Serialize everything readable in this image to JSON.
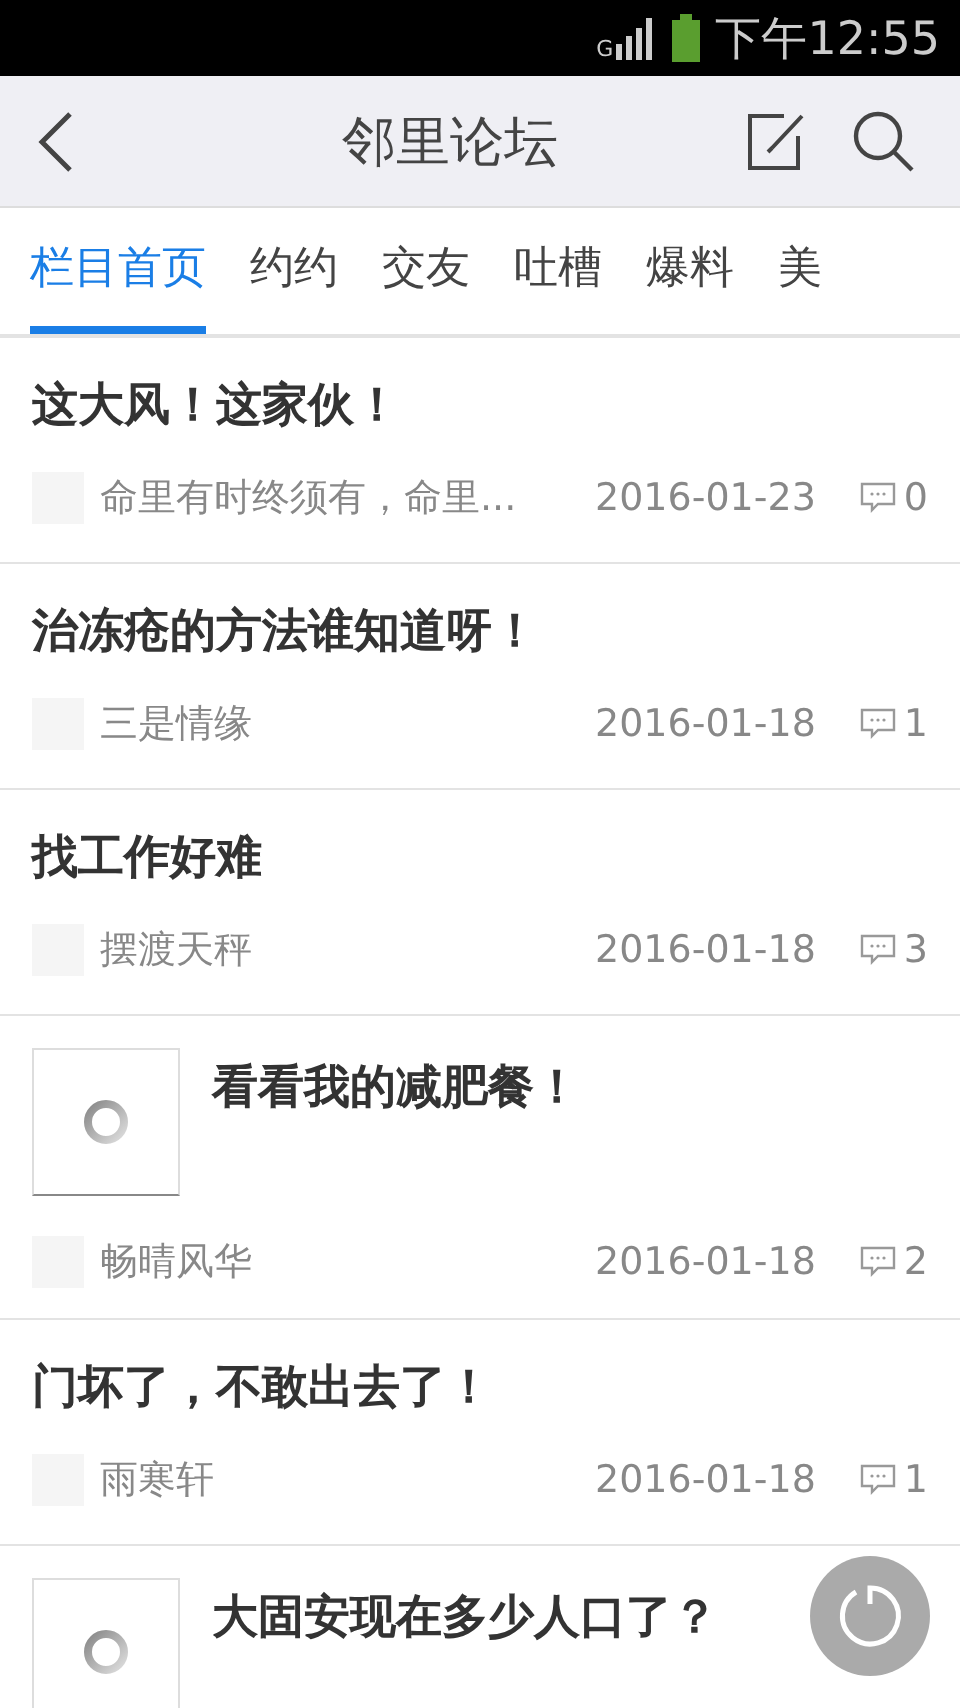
{
  "status_bar": {
    "network": "G",
    "time": "下午12:55"
  },
  "header": {
    "title": "邻里论坛"
  },
  "tabs": [
    {
      "label": "栏目首页",
      "selected": true
    },
    {
      "label": "约约",
      "selected": false
    },
    {
      "label": "交友",
      "selected": false
    },
    {
      "label": "吐槽",
      "selected": false
    },
    {
      "label": "爆料",
      "selected": false
    },
    {
      "label": "美",
      "selected": false
    }
  ],
  "posts": [
    {
      "kind": "text",
      "title": "这大风！这家伙！",
      "author": "命里有时终须有，命里...",
      "date": "2016-01-23",
      "comments": "0"
    },
    {
      "kind": "text",
      "title": "治冻疮的方法谁知道呀！",
      "author": "三是情缘",
      "date": "2016-01-18",
      "comments": "1"
    },
    {
      "kind": "text",
      "title": "找工作好难",
      "author": "摆渡天秤",
      "date": "2016-01-18",
      "comments": "3"
    },
    {
      "kind": "image",
      "title": "看看我的减肥餐！",
      "author": "畅晴风华",
      "date": "2016-01-18",
      "comments": "2"
    },
    {
      "kind": "text",
      "title": "门坏了，不敢出去了！",
      "author": "雨寒轩",
      "date": "2016-01-18",
      "comments": "1"
    },
    {
      "kind": "image",
      "title": "大固安现在多少人口了？"
    }
  ]
}
